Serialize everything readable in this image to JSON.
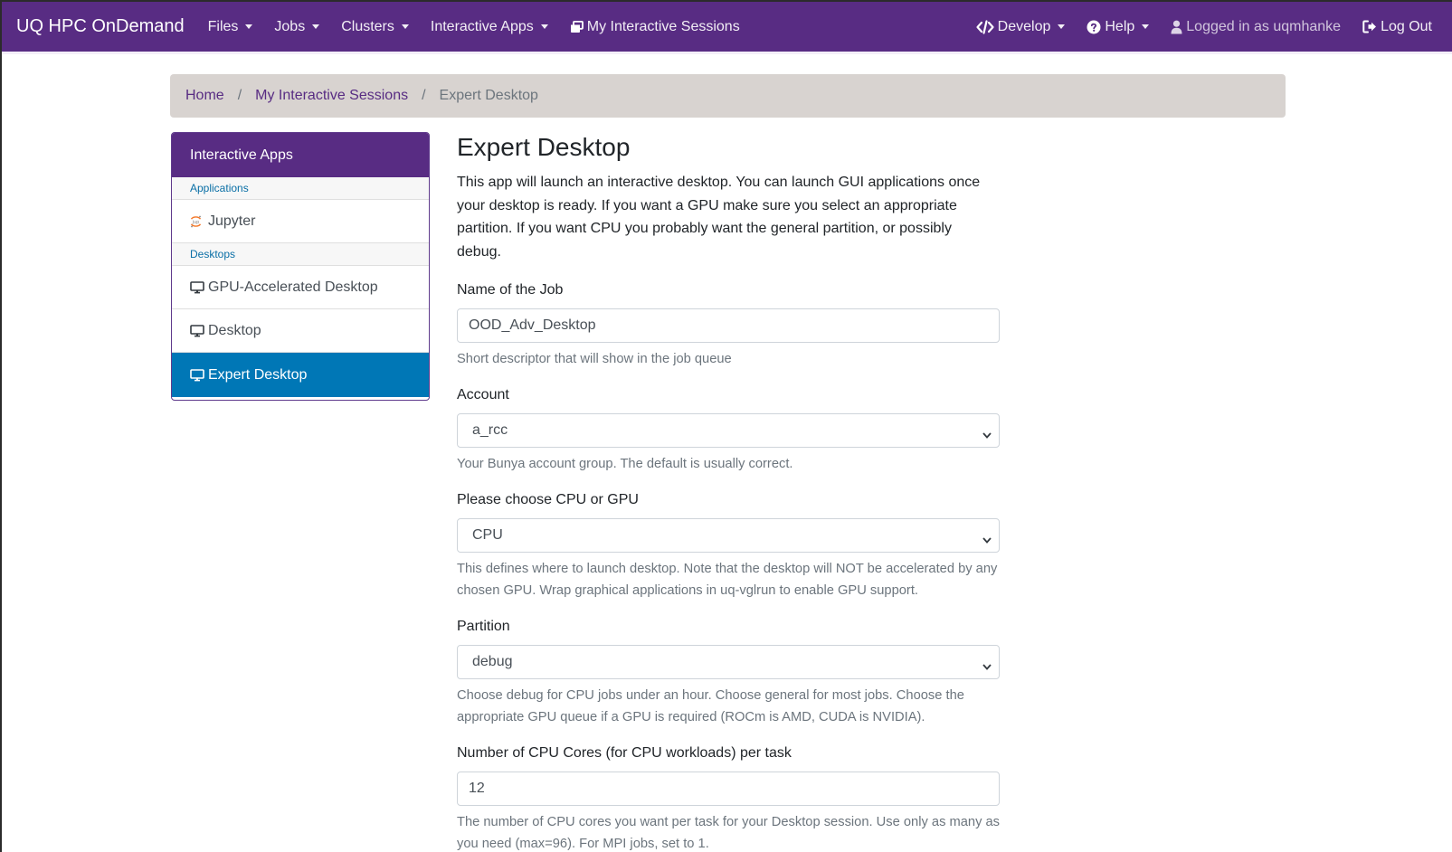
{
  "navbar": {
    "brand": "UQ HPC OnDemand",
    "left_items": [
      {
        "label": "Files"
      },
      {
        "label": "Jobs"
      },
      {
        "label": "Clusters"
      },
      {
        "label": "Interactive Apps"
      }
    ],
    "sessions_label": "My Interactive Sessions",
    "develop_label": "Develop",
    "help_label": "Help",
    "user_label": "Logged in as uqmhanke",
    "logout_label": "Log Out"
  },
  "breadcrumb": {
    "home": "Home",
    "sessions": "My Interactive Sessions",
    "current": "Expert Desktop"
  },
  "sidebar": {
    "header": "Interactive Apps",
    "group_applications": "Applications",
    "jupyter": "Jupyter",
    "group_desktops": "Desktops",
    "gpu_desktop": "GPU-Accelerated Desktop",
    "desktop": "Desktop",
    "expert_desktop": "Expert Desktop"
  },
  "main": {
    "title": "Expert Desktop",
    "intro": "This app will launch an interactive desktop. You can launch GUI applications once your desktop is ready. If you want a GPU make sure you select an appropriate partition. If you want CPU you probably want the general partition, or possibly debug.",
    "job_name": {
      "label": "Name of the Job",
      "value": "OOD_Adv_Desktop",
      "help": "Short descriptor that will show in the job queue"
    },
    "account": {
      "label": "Account",
      "value": "a_rcc",
      "help": "Your Bunya account group. The default is usually correct."
    },
    "cpu_gpu": {
      "label": "Please choose CPU or GPU",
      "value": "CPU",
      "help": "This defines where to launch desktop. Note that the desktop will NOT be accelerated by any chosen GPU. Wrap graphical applications in uq-vglrun to enable GPU support."
    },
    "partition": {
      "label": "Partition",
      "value": "debug",
      "help": "Choose debug for CPU jobs under an hour. Choose general for most jobs. Choose the appropriate GPU queue if a GPU is required (ROCm is AMD, CUDA is NVIDIA)."
    },
    "cpu_cores": {
      "label": "Number of CPU Cores (for CPU workloads) per task",
      "value": "12",
      "help": "The number of CPU cores you want per task for your Desktop session. Use only as many as you need (max=96). For MPI jobs, set to 1."
    }
  },
  "colors": {
    "navbar": "#582c83",
    "breadcrumb_bg": "#d8d3d0",
    "active_item": "#0077b6",
    "link": "#582c83"
  },
  "icons": {
    "sessions": "windows-icon",
    "develop": "code-icon",
    "help": "question-circle-icon",
    "user": "user-icon",
    "logout": "sign-out-icon",
    "jupyter": "jupyter-logo-icon",
    "desktop": "monitor-icon"
  }
}
